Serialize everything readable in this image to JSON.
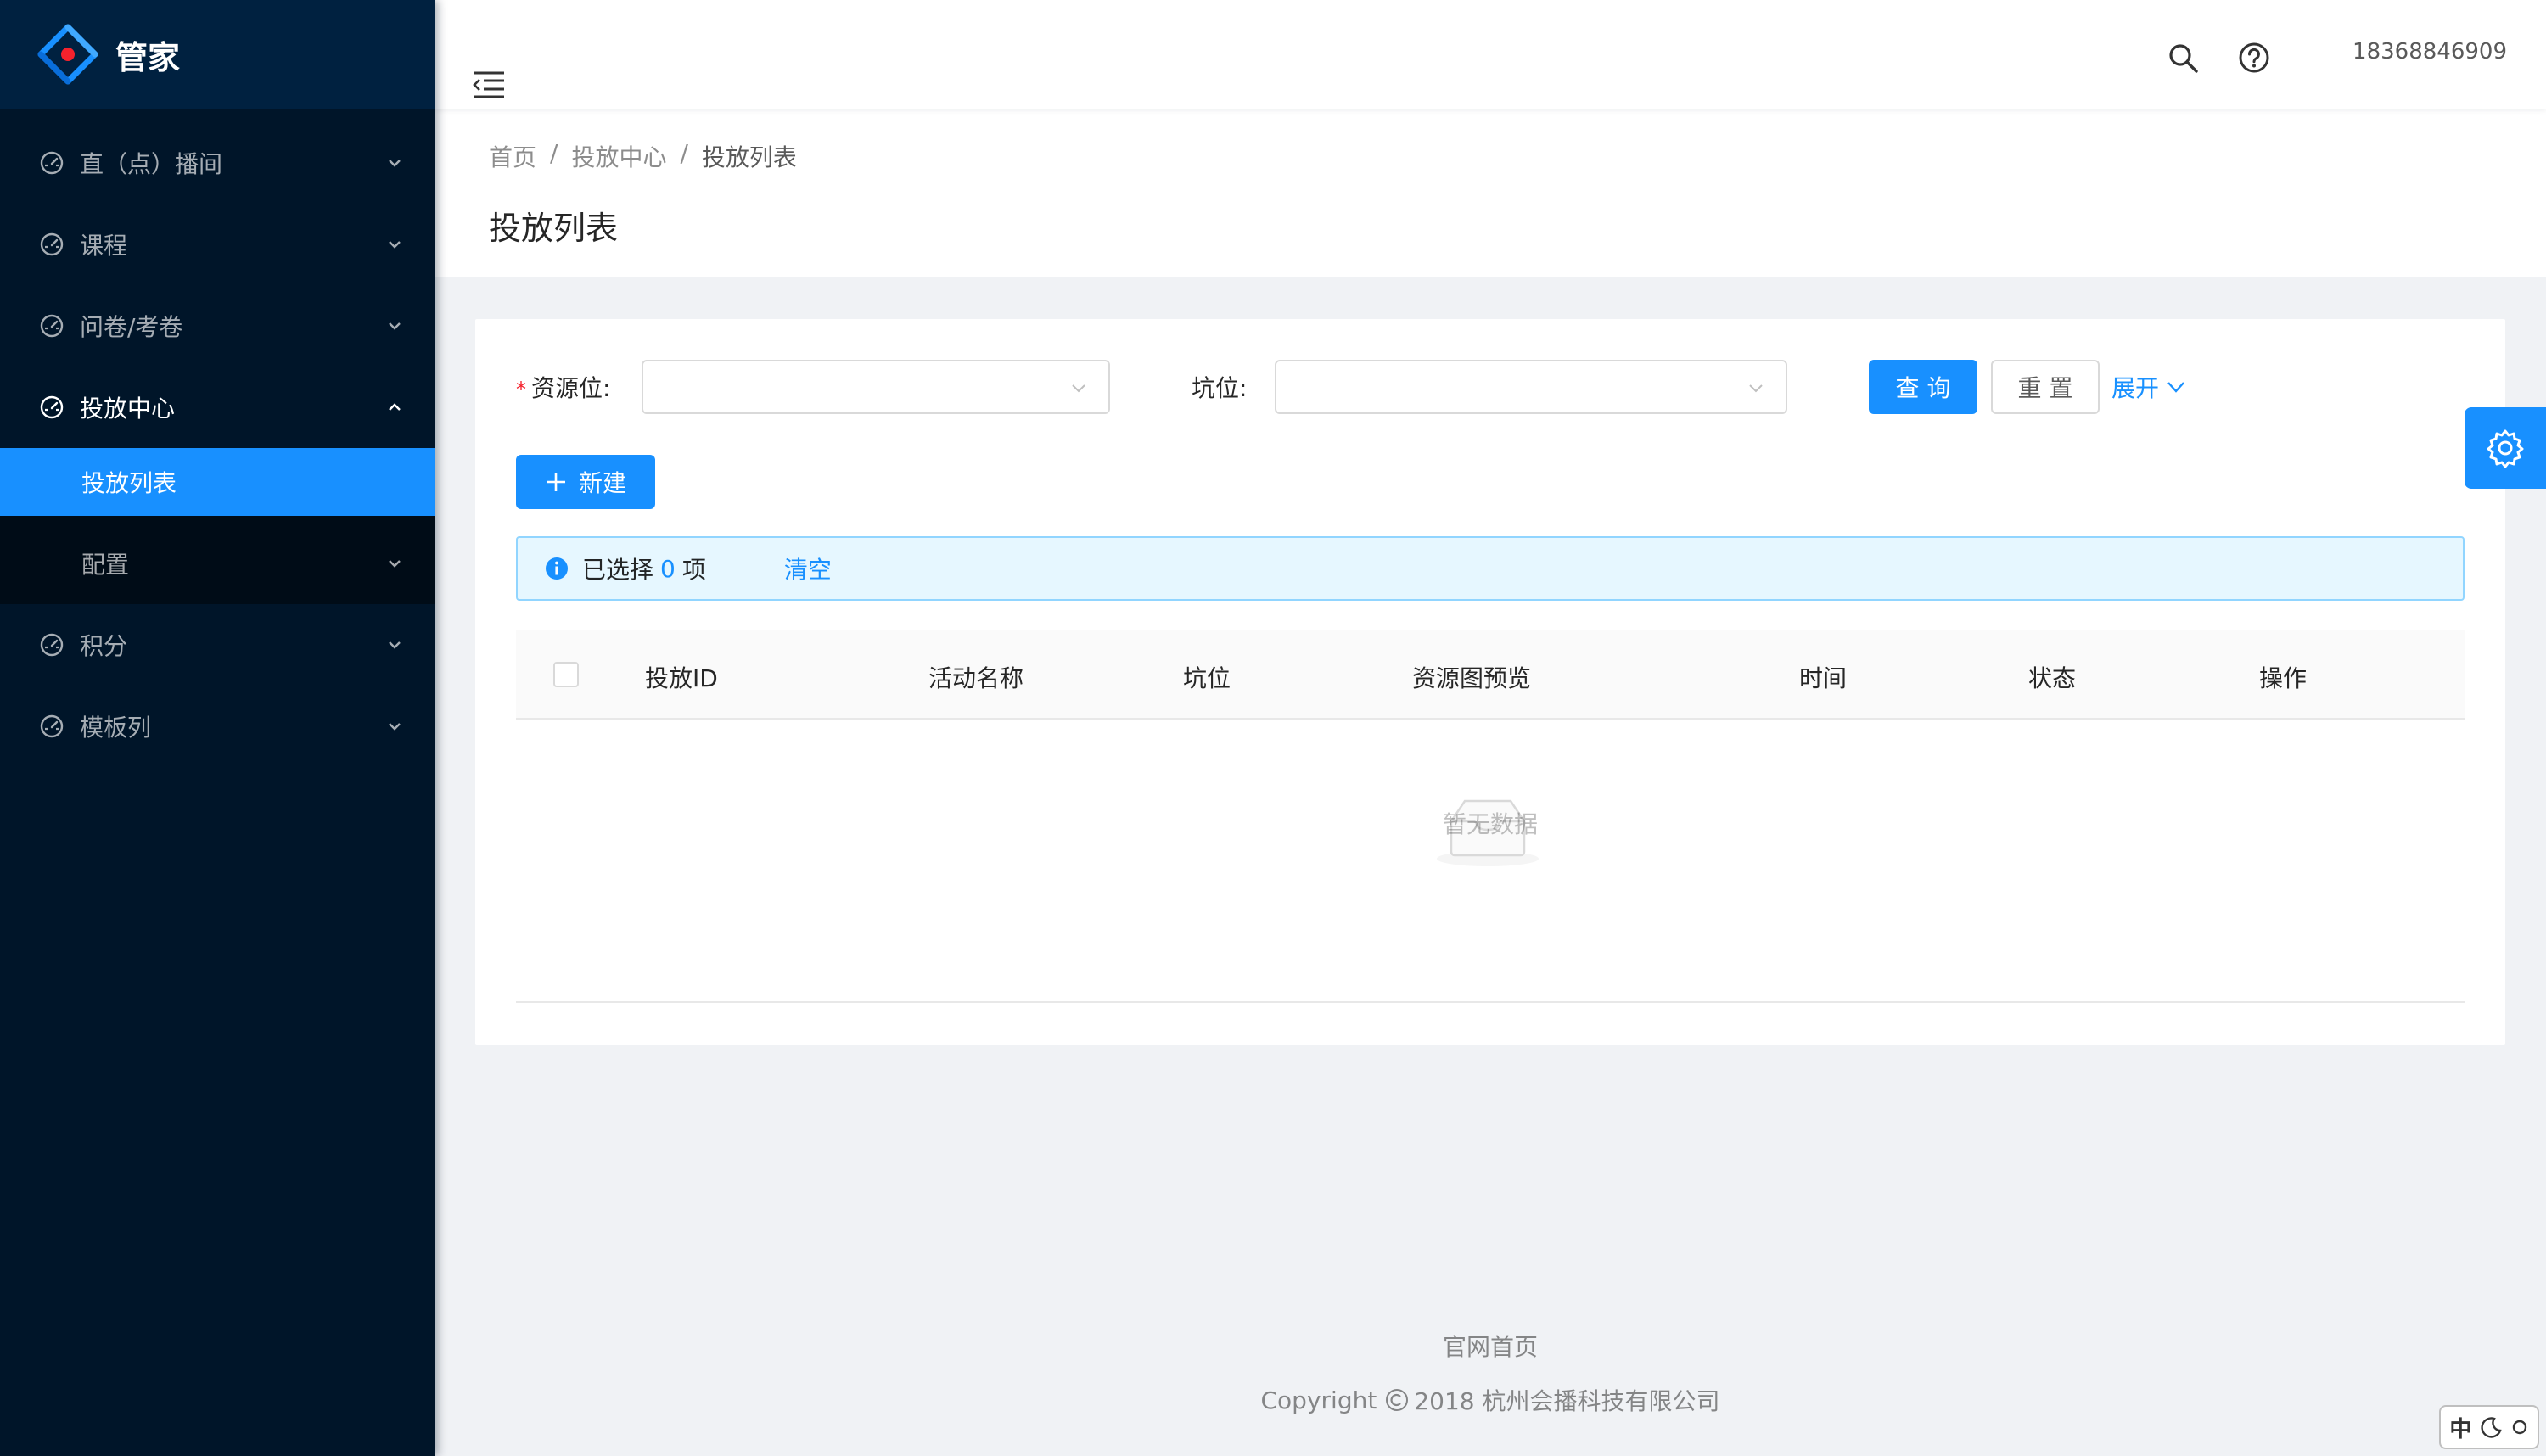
{
  "app": {
    "name": "管家"
  },
  "sidebar": {
    "items": [
      {
        "label": "直（点）播间",
        "icon": "dashboard-icon"
      },
      {
        "label": "课程",
        "icon": "dashboard-icon"
      },
      {
        "label": "问卷/考卷",
        "icon": "dashboard-icon"
      },
      {
        "label": "投放中心",
        "icon": "dashboard-icon",
        "open": true,
        "children": [
          {
            "label": "投放列表",
            "active": true
          },
          {
            "label": "配置"
          }
        ]
      },
      {
        "label": "积分",
        "icon": "dashboard-icon"
      },
      {
        "label": "模板列",
        "icon": "dashboard-icon"
      }
    ]
  },
  "header": {
    "user": "18368846909"
  },
  "breadcrumb": [
    "首页",
    "投放中心",
    "投放列表"
  ],
  "page": {
    "title": "投放列表"
  },
  "filters": {
    "resource_label": "资源位:",
    "slot_label": "坑位:",
    "resource_value": "",
    "slot_value": "",
    "query_button": "查 询",
    "reset_button": "重 置",
    "expand_link": "展开"
  },
  "actions": {
    "new_button": "新建"
  },
  "selection": {
    "prefix": "已选择",
    "count": "0",
    "suffix": "项",
    "clear": "清空"
  },
  "table": {
    "columns": [
      "投放ID",
      "活动名称",
      "坑位",
      "资源图预览",
      "时间",
      "状态",
      "操作"
    ],
    "empty_text": "暂无数据"
  },
  "footer": {
    "link": "官网首页",
    "copyright_prefix": "Copyright",
    "copyright_text": "2018 杭州会播科技有限公司"
  },
  "ime": {
    "mode": "中"
  },
  "colors": {
    "primary": "#1890ff",
    "sidebar": "#001529",
    "danger": "#f5222d"
  }
}
